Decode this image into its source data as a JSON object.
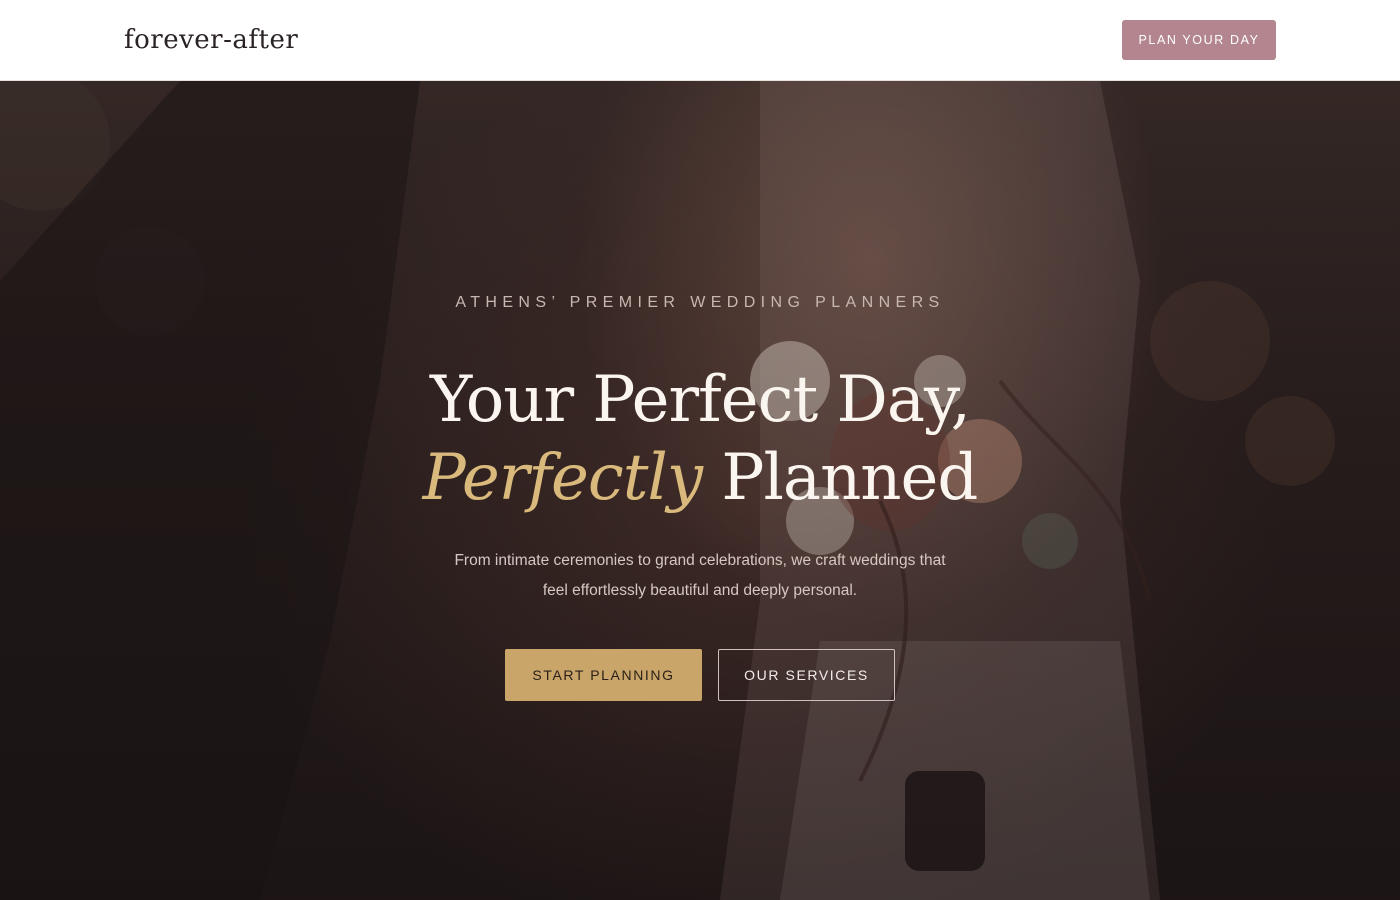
{
  "header": {
    "logo_text": "forever-after",
    "cta_label": "PLAN YOUR DAY"
  },
  "hero": {
    "eyebrow": "ATHENS’ PREMIER WEDDING PLANNERS",
    "headline_line1": "Your Perfect Day,",
    "headline_accent": "Perfectly",
    "headline_rest": " Planned",
    "subtext_line1": "From intimate ceremonies to grand celebrations, we craft weddings that",
    "subtext_line2": "feel effortlessly beautiful and deeply personal.",
    "primary_button": "START PLANNING",
    "secondary_button": "OUR SERVICES",
    "image_subject": "bride-holding-bouquet-photo"
  },
  "colors": {
    "nav_cta": "#b3868f",
    "accent_gold": "#d9b97c",
    "primary_button": "#c9a56a",
    "hero_dark": "#201819"
  }
}
